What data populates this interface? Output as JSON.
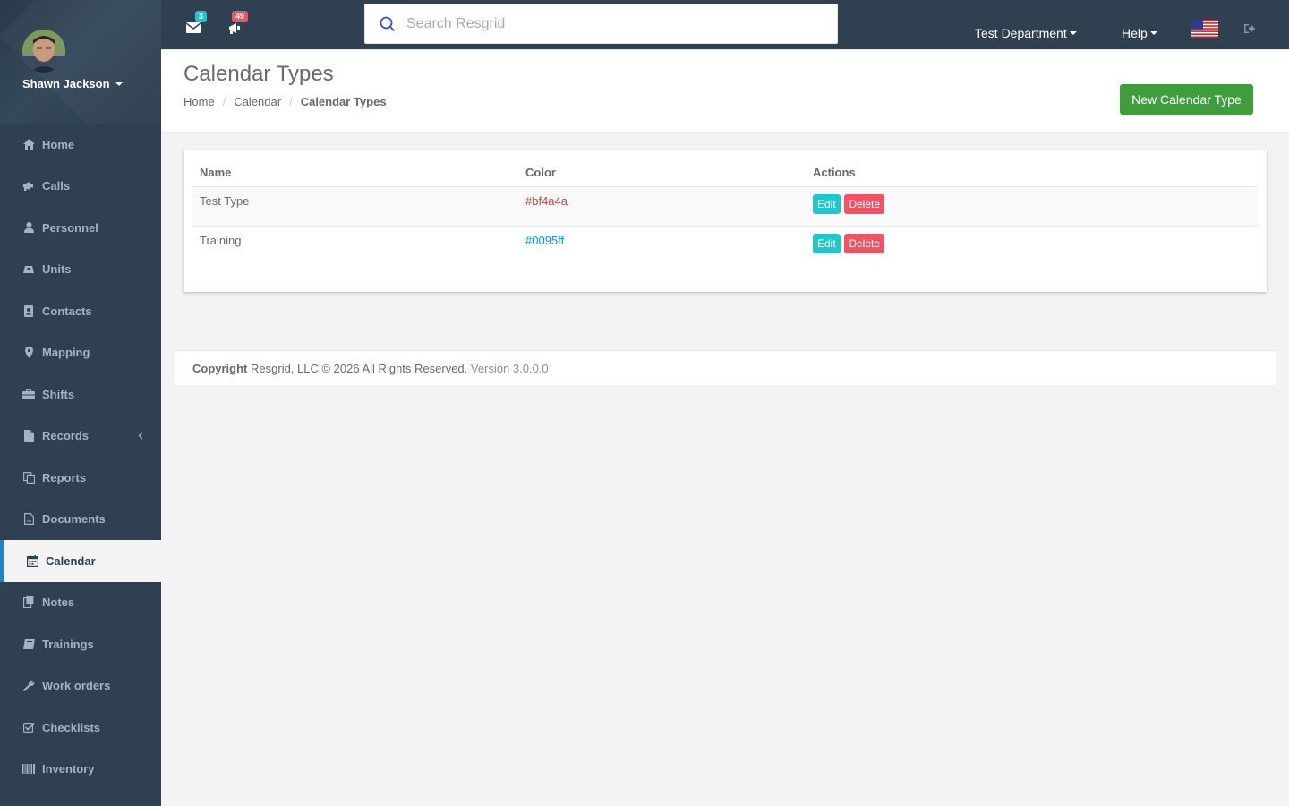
{
  "user": {
    "name": "Shawn Jackson"
  },
  "sidebar": {
    "items": [
      {
        "label": "Home",
        "icon": "home-icon"
      },
      {
        "label": "Calls",
        "icon": "bullhorn-icon"
      },
      {
        "label": "Personnel",
        "icon": "user-icon"
      },
      {
        "label": "Units",
        "icon": "truck-icon"
      },
      {
        "label": "Contacts",
        "icon": "address-book-icon"
      },
      {
        "label": "Mapping",
        "icon": "map-marker-icon"
      },
      {
        "label": "Shifts",
        "icon": "briefcase-icon"
      },
      {
        "label": "Records",
        "icon": "file-icon",
        "expandable": true
      },
      {
        "label": "Reports",
        "icon": "copy-icon"
      },
      {
        "label": "Documents",
        "icon": "file-text-icon"
      },
      {
        "label": "Calendar",
        "icon": "calendar-icon",
        "active": true
      },
      {
        "label": "Notes",
        "icon": "clipboard-icon"
      },
      {
        "label": "Trainings",
        "icon": "book-icon"
      },
      {
        "label": "Work orders",
        "icon": "wrench-icon"
      },
      {
        "label": "Checklists",
        "icon": "check-square-icon"
      },
      {
        "label": "Inventory",
        "icon": "barcode-icon"
      }
    ]
  },
  "topbar": {
    "messages_count": "3",
    "calls_count": "49",
    "search_placeholder": "Search Resgrid",
    "department": "Test Department",
    "help": "Help"
  },
  "page": {
    "title": "Calendar Types",
    "breadcrumb": [
      "Home",
      "Calendar",
      "Calendar Types"
    ],
    "new_button": "New Calendar Type"
  },
  "table": {
    "headers": [
      "Name",
      "Color",
      "Actions"
    ],
    "rows": [
      {
        "name": "Test Type",
        "color": "#bf4a4a"
      },
      {
        "name": "Training",
        "color": "#0095ff"
      }
    ],
    "edit_label": "Edit",
    "delete_label": "Delete"
  },
  "footer": {
    "copyright_label": "Copyright",
    "copyright_text": "Resgrid, LLC © 2026 All Rights Reserved.",
    "version": "Version 3.0.0.0"
  },
  "colors": {
    "sidebar_bg": "#2f4050",
    "accent_green": "#409d3e",
    "info": "#23c6c8",
    "danger": "#ed5565"
  }
}
